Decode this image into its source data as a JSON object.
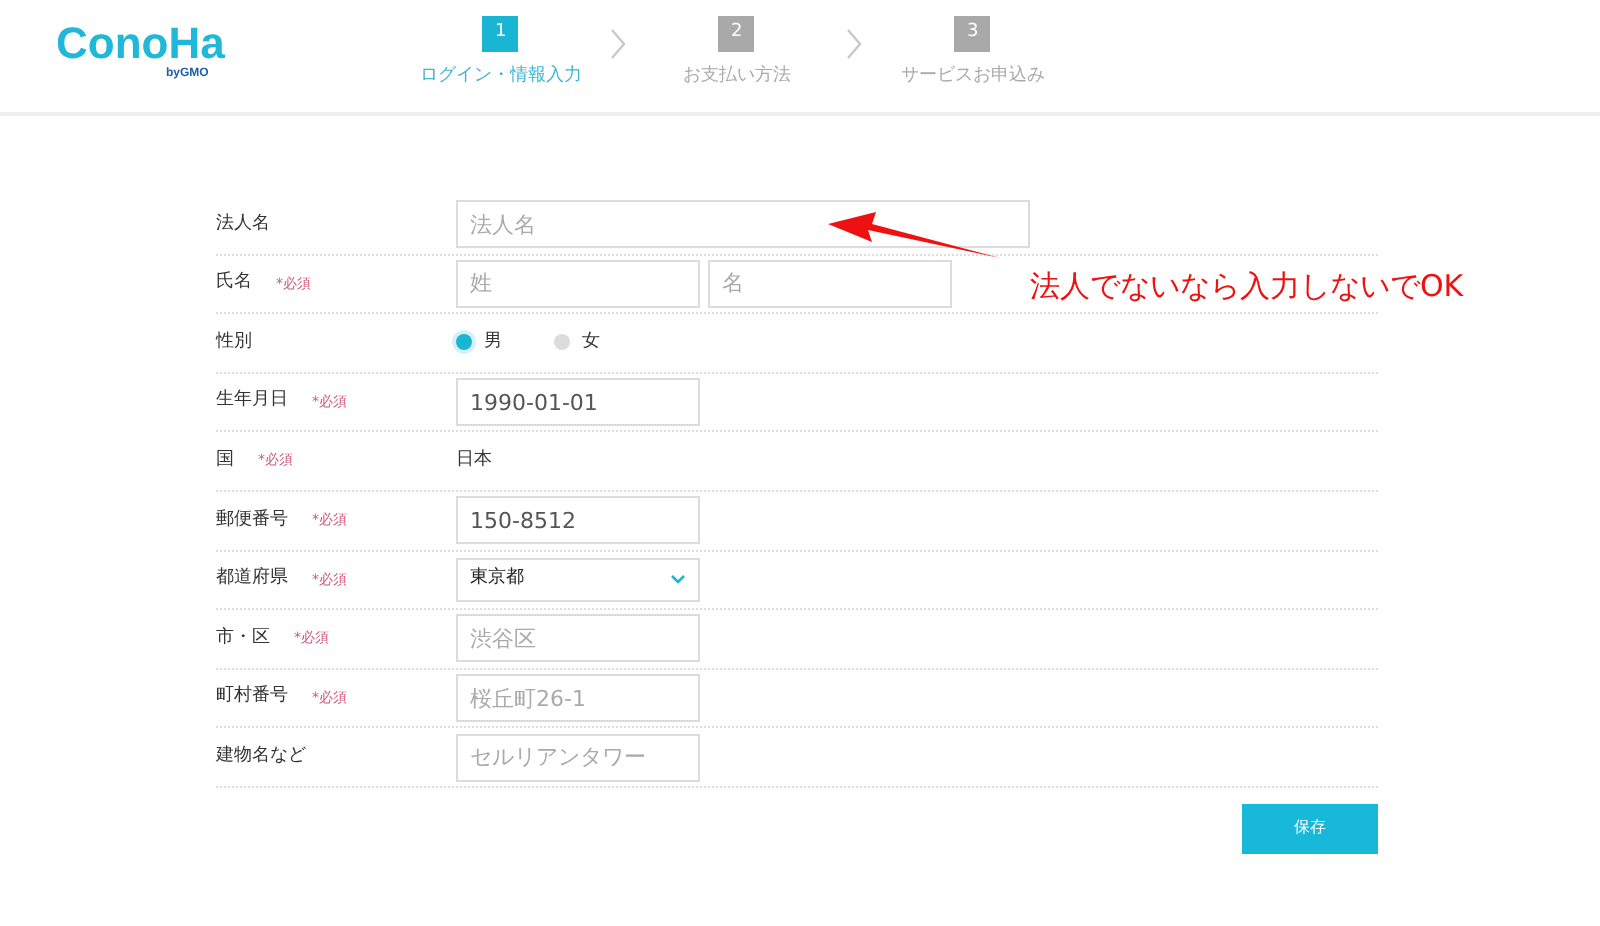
{
  "logo": {
    "name": "ConoHa",
    "sub": "byGMO"
  },
  "steps": [
    {
      "number": "1",
      "label": "ログイン・情報入力",
      "selected": true
    },
    {
      "number": "2",
      "label": "お支払い方法",
      "selected": false
    },
    {
      "number": "3",
      "label": "サービスお申込み",
      "selected": false
    }
  ],
  "form": {
    "rows": [
      {
        "label": "法人名",
        "kind": "input",
        "fields": [
          {
            "placeholder": "法人名",
            "wide": true
          }
        ]
      },
      {
        "label": "氏名",
        "required_mark": "*必須",
        "kind": "input",
        "fields": [
          {
            "placeholder": "姓"
          },
          {
            "placeholder": "名"
          }
        ]
      },
      {
        "label": "性別",
        "kind": "radio",
        "options": [
          {
            "label": "男",
            "selected": true
          },
          {
            "label": "女",
            "selected": false
          }
        ]
      },
      {
        "label": "生年月日",
        "required_mark": "*必須",
        "kind": "input",
        "fields": [
          {
            "value": "1990-01-01"
          }
        ]
      },
      {
        "label": "国",
        "required_mark": "*必須",
        "kind": "text",
        "text": "日本"
      },
      {
        "label": "郵便番号",
        "required_mark": "*必須",
        "kind": "input",
        "fields": [
          {
            "value": "150-8512"
          }
        ]
      },
      {
        "label": "都道府県",
        "required_mark": "*必須",
        "kind": "select",
        "value": "東京都"
      },
      {
        "label": "市・区",
        "required_mark": "*必須",
        "kind": "input",
        "fields": [
          {
            "placeholder": "渋谷区"
          }
        ]
      },
      {
        "label": "町村番号",
        "required_mark": "*必須",
        "kind": "input",
        "fields": [
          {
            "placeholder": "桜丘町26-1"
          }
        ]
      },
      {
        "label": "建物名など",
        "kind": "input",
        "fields": [
          {
            "placeholder": "セルリアンタワー"
          }
        ]
      }
    ],
    "save_button": "保存"
  },
  "annotation": {
    "text": "法人でないなら入力しないでOK"
  }
}
